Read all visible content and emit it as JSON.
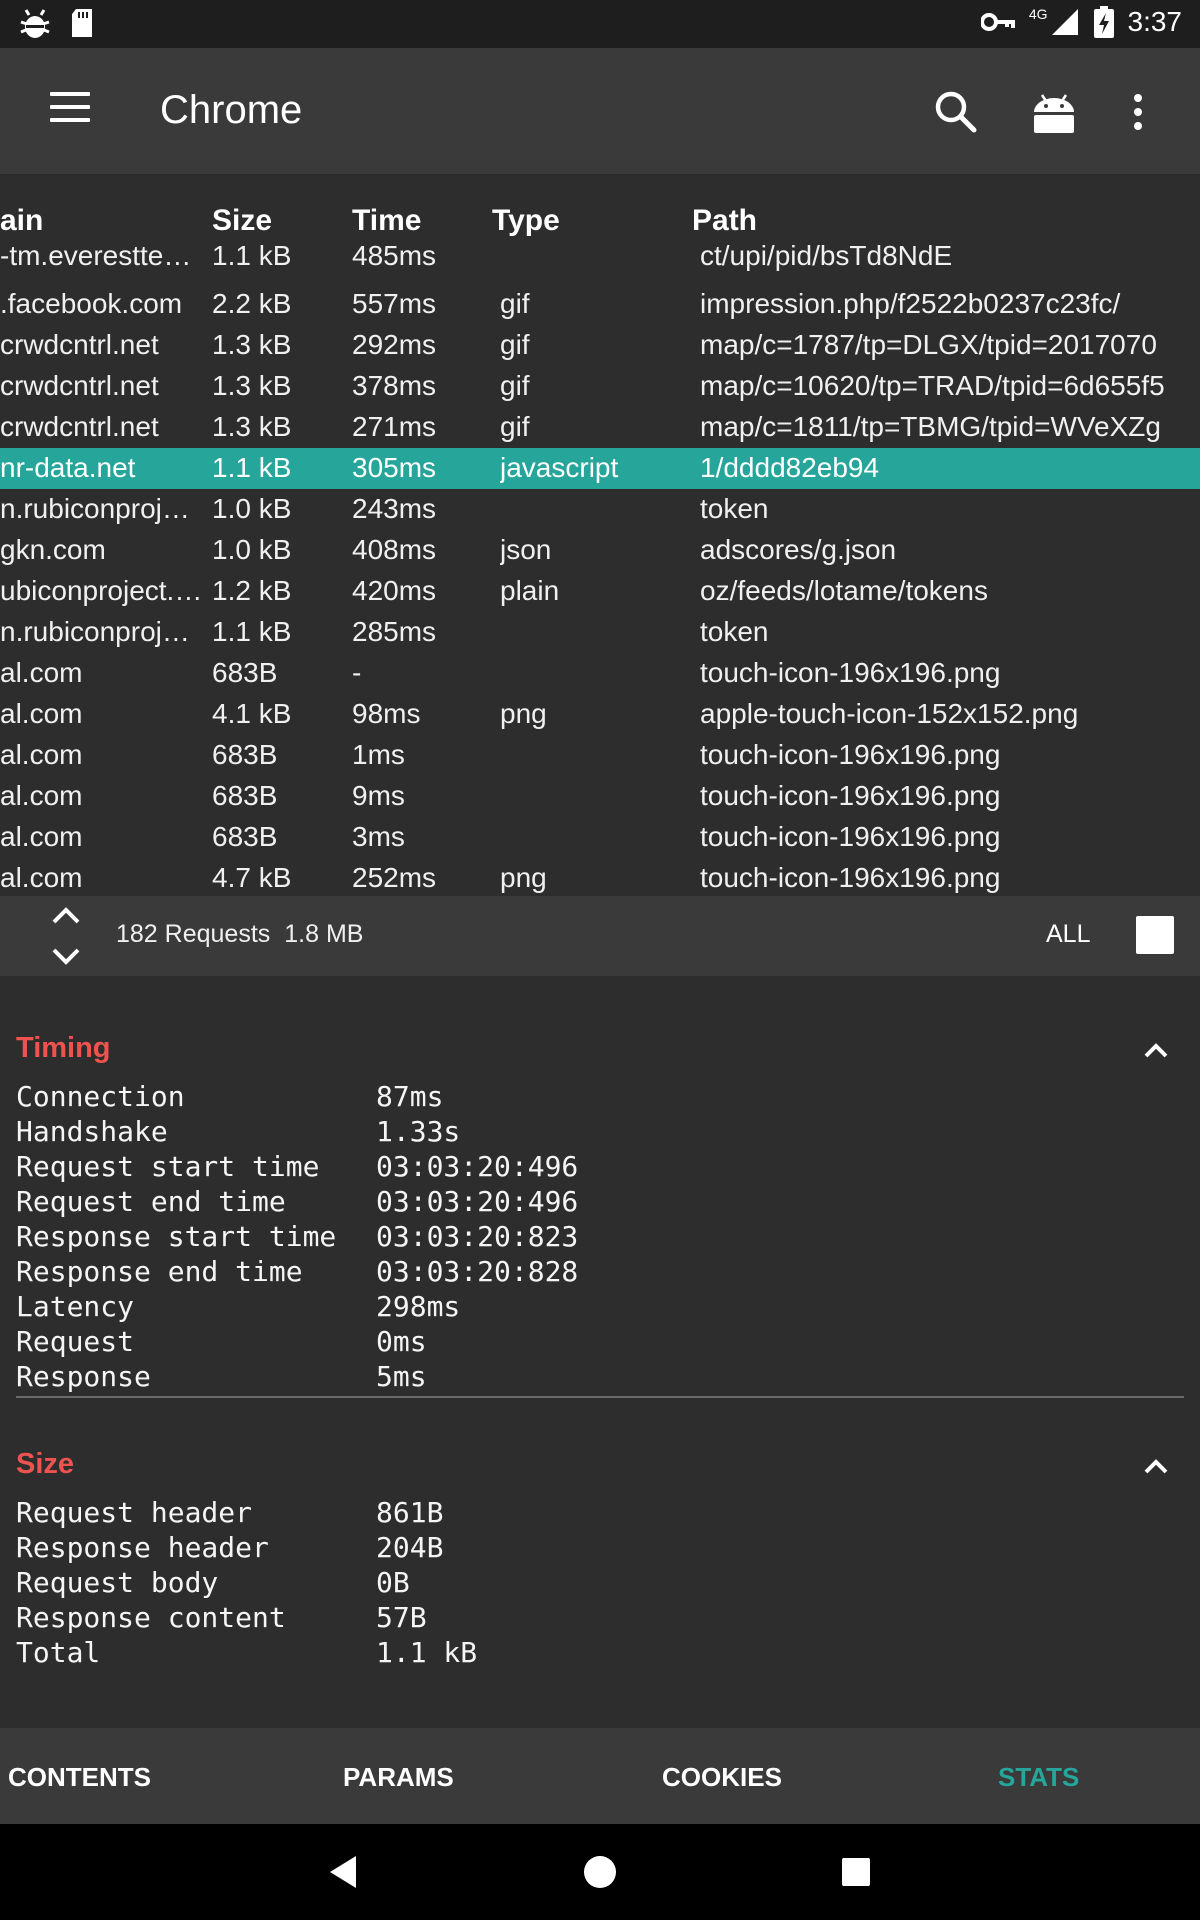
{
  "status_bar": {
    "time": "3:37",
    "network": "4G",
    "icons": [
      "bug-icon",
      "sd-card-icon",
      "vpn-key-icon",
      "signal-icon",
      "battery-charging-icon"
    ]
  },
  "app_bar": {
    "title": "Chrome",
    "icons": [
      "menu-icon",
      "search-icon",
      "android-icon",
      "more-vert-icon"
    ]
  },
  "table": {
    "headers": {
      "domain": "ain",
      "size": "Size",
      "time": "Time",
      "type": "Type",
      "path": "Path"
    },
    "rows": [
      {
        "domain": "-tm.everesttec…",
        "size": "1.1 kB",
        "time": "485ms",
        "type": "",
        "path": "ct/upi/pid/bsTd8NdE"
      },
      {
        "domain": ".facebook.com",
        "size": "2.2 kB",
        "time": "557ms",
        "type": "gif",
        "path": "impression.php/f2522b0237c23fc/"
      },
      {
        "domain": "crwdcntrl.net",
        "size": "1.3 kB",
        "time": "292ms",
        "type": "gif",
        "path": "map/c=1787/tp=DLGX/tpid=2017070"
      },
      {
        "domain": "crwdcntrl.net",
        "size": "1.3 kB",
        "time": "378ms",
        "type": "gif",
        "path": "map/c=10620/tp=TRAD/tpid=6d655f5"
      },
      {
        "domain": "crwdcntrl.net",
        "size": "1.3 kB",
        "time": "271ms",
        "type": "gif",
        "path": "map/c=1811/tp=TBMG/tpid=WVeXZg"
      },
      {
        "domain": "nr-data.net",
        "size": "1.1 kB",
        "time": "305ms",
        "type": "javascript",
        "path": "1/dddd82eb94"
      },
      {
        "domain": "n.rubiconproje…",
        "size": "1.0 kB",
        "time": "243ms",
        "type": "",
        "path": "token"
      },
      {
        "domain": "gkn.com",
        "size": "1.0 kB",
        "time": "408ms",
        "type": "json",
        "path": "adscores/g.json"
      },
      {
        "domain": "ubiconproject.…",
        "size": "1.2 kB",
        "time": "420ms",
        "type": "plain",
        "path": "oz/feeds/lotame/tokens"
      },
      {
        "domain": "n.rubiconproje…",
        "size": "1.1 kB",
        "time": "285ms",
        "type": "",
        "path": "token"
      },
      {
        "domain": "al.com",
        "size": "683B",
        "time": "-",
        "type": "",
        "path": "touch-icon-196x196.png"
      },
      {
        "domain": "al.com",
        "size": "4.1 kB",
        "time": "98ms",
        "type": "png",
        "path": "apple-touch-icon-152x152.png"
      },
      {
        "domain": "al.com",
        "size": "683B",
        "time": "1ms",
        "type": "",
        "path": "touch-icon-196x196.png"
      },
      {
        "domain": "al.com",
        "size": "683B",
        "time": "9ms",
        "type": "",
        "path": "touch-icon-196x196.png"
      },
      {
        "domain": "al.com",
        "size": "683B",
        "time": "3ms",
        "type": "",
        "path": "touch-icon-196x196.png"
      },
      {
        "domain": "al.com",
        "size": "4.7 kB",
        "time": "252ms",
        "type": "png",
        "path": "touch-icon-196x196.png"
      }
    ],
    "selected_row_index": 5
  },
  "summary": {
    "requests": "182 Requests",
    "total_size": "1.8 MB",
    "filter_label": "ALL",
    "filter_checked": false
  },
  "timing": {
    "title": "Timing",
    "items": [
      {
        "key": "Connection",
        "value": "87ms"
      },
      {
        "key": "Handshake",
        "value": "1.33s"
      },
      {
        "key": "Request start time",
        "value": "03:03:20:496"
      },
      {
        "key": "Request end time",
        "value": "03:03:20:496"
      },
      {
        "key": "Response start time",
        "value": "03:03:20:823"
      },
      {
        "key": "Response end time",
        "value": "03:03:20:828"
      },
      {
        "key": "Latency",
        "value": "298ms"
      },
      {
        "key": "Request",
        "value": "0ms"
      },
      {
        "key": "Response",
        "value": "5ms"
      }
    ]
  },
  "size": {
    "title": "Size",
    "items": [
      {
        "key": "Request header",
        "value": "861B"
      },
      {
        "key": "Response header",
        "value": "204B"
      },
      {
        "key": "Request body",
        "value": "0B"
      },
      {
        "key": "Response content",
        "value": "57B"
      },
      {
        "key": "Total",
        "value": "1.1 kB"
      }
    ]
  },
  "tabs": {
    "items": [
      "CONTENTS",
      "PARAMS",
      "COOKIES",
      "STATS"
    ],
    "active": "STATS"
  },
  "colors": {
    "accent": "#26a69a",
    "section_title": "#ef5350",
    "background": "#2d2d2d",
    "bar": "#3a3a3a"
  }
}
